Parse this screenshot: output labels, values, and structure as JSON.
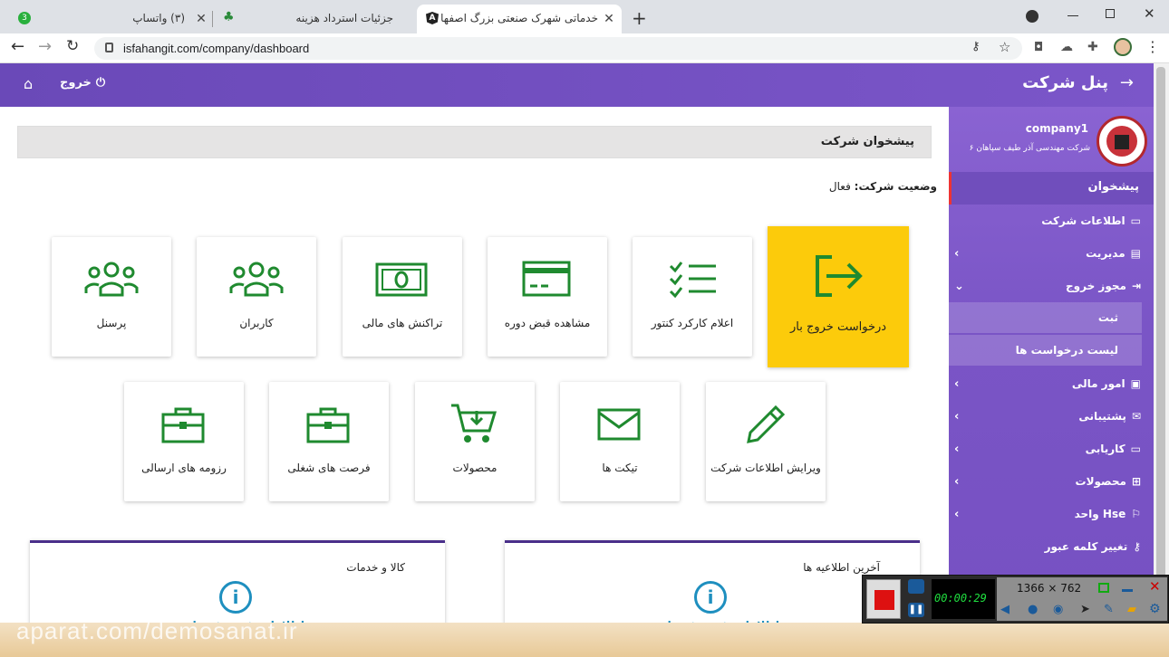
{
  "browser": {
    "tabs": [
      {
        "title": "(۳) واتساپ",
        "badge": "3"
      },
      {
        "title": "جزئیات استرداد هزینه"
      },
      {
        "title": "خدماتی شهرک صنعتی بزرگ اصفها"
      }
    ],
    "url": "isfahangit.com/company/dashboard"
  },
  "header": {
    "title": "پنل شرکت",
    "logout_label": "خروج"
  },
  "profile": {
    "username": "company1",
    "company_name": "شرکت مهندسی آذر طیف سپاهان ۶"
  },
  "sidebar": {
    "active_label": "پیشخوان",
    "items": [
      {
        "label": "اطلاعات شرکت",
        "icon": "briefcase-icon"
      },
      {
        "label": "مدیریت",
        "icon": "chart-icon",
        "chevron": "‹"
      },
      {
        "label": "مجوز خروج",
        "icon": "exit-icon",
        "chevron": "⌄"
      },
      {
        "label": "امور مالی",
        "icon": "money-icon",
        "chevron": "‹"
      },
      {
        "label": "پشتیبانی",
        "icon": "mail-icon",
        "chevron": "‹"
      },
      {
        "label": "کاریابی",
        "icon": "briefcase-icon",
        "chevron": "‹"
      },
      {
        "label": "محصولات",
        "icon": "cart-icon",
        "chevron": "‹"
      },
      {
        "label": "واحد Hse",
        "icon": "hse-icon",
        "chevron": "‹"
      },
      {
        "label": "تغییر کلمه عبور",
        "icon": "key-icon"
      }
    ],
    "subitems": [
      "ثبت",
      "لیست درخواست ها"
    ]
  },
  "main": {
    "welcome_title": "پیشخوان شرکت",
    "status_label": "وضعیت شرکت:",
    "status_value": "فعال",
    "tiles_row1": [
      {
        "label": "درخواست خروج بار",
        "icon": "exit-icon",
        "highlight": true
      },
      {
        "label": "اعلام کارکرد کنتور",
        "icon": "checklist-icon"
      },
      {
        "label": "مشاهده قبض دوره",
        "icon": "credit-card-icon"
      },
      {
        "label": "تراکنش های مالی",
        "icon": "money-icon"
      },
      {
        "label": "کاربران",
        "icon": "users-icon"
      },
      {
        "label": "پرسنل",
        "icon": "users-icon"
      }
    ],
    "tiles_row2": [
      {
        "label": "ویرایش اطلاعات شرکت",
        "icon": "pencil-icon"
      },
      {
        "label": "تیکت ها",
        "icon": "envelope-icon"
      },
      {
        "label": "محصولات",
        "icon": "cart-icon"
      },
      {
        "label": "فرصت های شغلی",
        "icon": "briefcase-icon"
      },
      {
        "label": "رزومه های ارسالی",
        "icon": "briefcase-icon"
      }
    ],
    "cards": [
      {
        "title": "آخرین اطلاعیه ها",
        "body": "اطلاعاتی ثبت نشده است"
      },
      {
        "title": "کالا و خدمات",
        "body": "اطلاعاتی ثبت نشده است"
      }
    ]
  },
  "recorder": {
    "resolution": "1366 × 762",
    "timer": "00:00:29"
  },
  "watermark": "aparat.com/demosanat.ir",
  "colors": {
    "header": "#6a49b8",
    "accent_green": "#1f8a2f",
    "highlight_tile": "#fccb0b"
  }
}
